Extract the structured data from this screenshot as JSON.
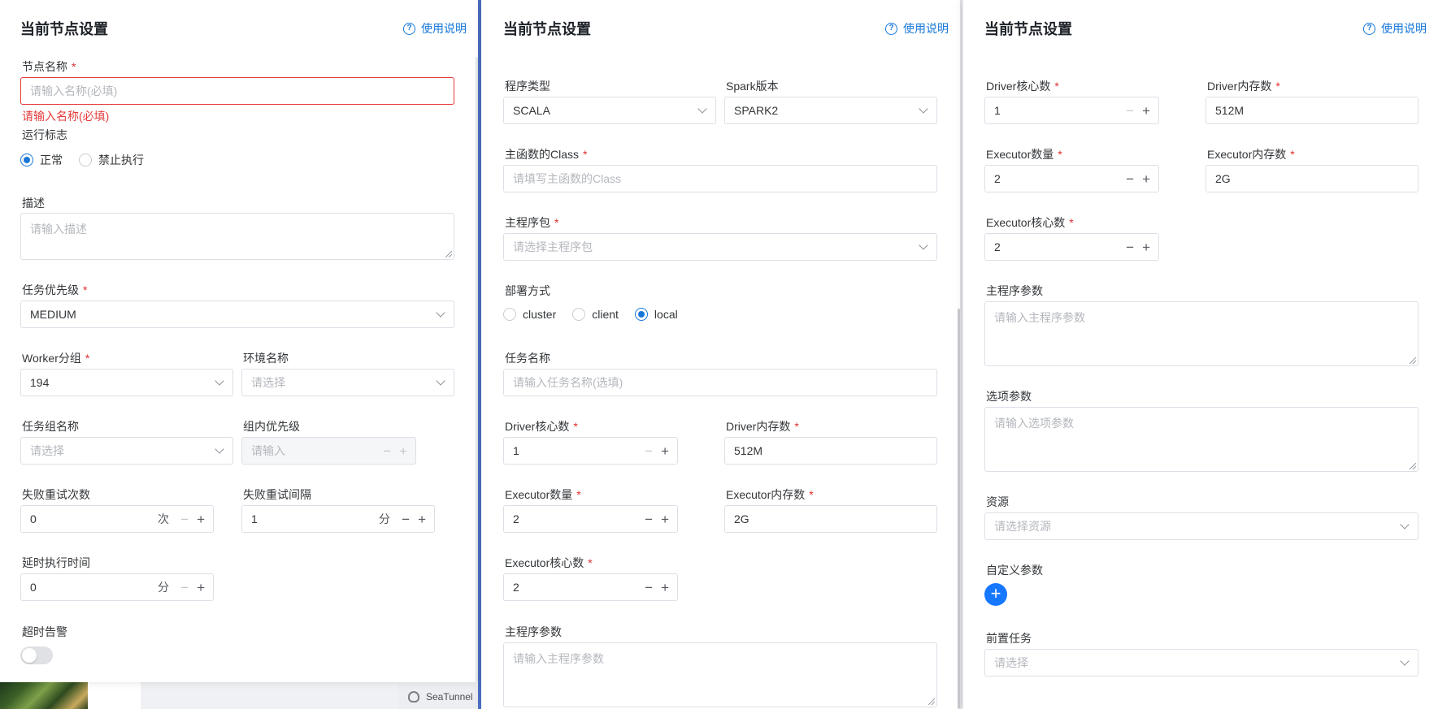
{
  "colors": {
    "accent": "#1677d9",
    "error": "#e53b3b",
    "required": "#e03030"
  },
  "background": {
    "tab_label": "SeaTunnel"
  },
  "panel1": {
    "title": "当前节点设置",
    "help": "使用说明",
    "node_name": {
      "label": "节点名称",
      "placeholder": "请输入名称(必填)",
      "error": "请输入名称(必填)"
    },
    "run_flag": {
      "label": "运行标志",
      "options": [
        "正常",
        "禁止执行"
      ],
      "selected": "正常"
    },
    "description": {
      "label": "描述",
      "placeholder": "请输入描述"
    },
    "priority": {
      "label": "任务优先级",
      "value": "MEDIUM"
    },
    "worker_group": {
      "label": "Worker分组",
      "value": "194"
    },
    "env_name": {
      "label": "环境名称",
      "placeholder": "请选择"
    },
    "task_group": {
      "label": "任务组名称",
      "placeholder": "请选择"
    },
    "group_priority": {
      "label": "组内优先级",
      "placeholder": "请输入"
    },
    "retry_times": {
      "label": "失败重试次数",
      "value": "0",
      "unit": "次"
    },
    "retry_interval": {
      "label": "失败重试间隔",
      "value": "1",
      "unit": "分"
    },
    "delay_time": {
      "label": "延时执行时间",
      "value": "0",
      "unit": "分"
    },
    "timeout_alarm": {
      "label": "超时告警",
      "enabled": false
    }
  },
  "panel2": {
    "title": "当前节点设置",
    "help": "使用说明",
    "program_type": {
      "label": "程序类型",
      "value": "SCALA"
    },
    "spark_version": {
      "label": "Spark版本",
      "value": "SPARK2"
    },
    "main_class": {
      "label": "主函数的Class",
      "placeholder": "请填写主函数的Class"
    },
    "main_package": {
      "label": "主程序包",
      "placeholder": "请选择主程序包"
    },
    "deploy_mode": {
      "label": "部署方式",
      "options": [
        "cluster",
        "client",
        "local"
      ],
      "selected": "local"
    },
    "task_name": {
      "label": "任务名称",
      "placeholder": "请输入任务名称(选填)"
    },
    "driver_cores": {
      "label": "Driver核心数",
      "value": "1"
    },
    "driver_memory": {
      "label": "Driver内存数",
      "value": "512M"
    },
    "executor_count": {
      "label": "Executor数量",
      "value": "2"
    },
    "executor_memory": {
      "label": "Executor内存数",
      "value": "2G"
    },
    "executor_cores": {
      "label": "Executor核心数",
      "value": "2"
    },
    "main_args": {
      "label": "主程序参数",
      "placeholder": "请输入主程序参数"
    }
  },
  "panel3": {
    "title": "当前节点设置",
    "help": "使用说明",
    "driver_cores": {
      "label": "Driver核心数",
      "value": "1"
    },
    "driver_memory": {
      "label": "Driver内存数",
      "value": "512M"
    },
    "executor_count": {
      "label": "Executor数量",
      "value": "2"
    },
    "executor_memory": {
      "label": "Executor内存数",
      "value": "2G"
    },
    "executor_cores": {
      "label": "Executor核心数",
      "value": "2"
    },
    "main_args": {
      "label": "主程序参数",
      "placeholder": "请输入主程序参数"
    },
    "option_args": {
      "label": "选项参数",
      "placeholder": "请输入选项参数"
    },
    "resources": {
      "label": "资源",
      "placeholder": "请选择资源"
    },
    "custom_params": {
      "label": "自定义参数"
    },
    "pre_tasks": {
      "label": "前置任务",
      "placeholder": "请选择"
    }
  }
}
